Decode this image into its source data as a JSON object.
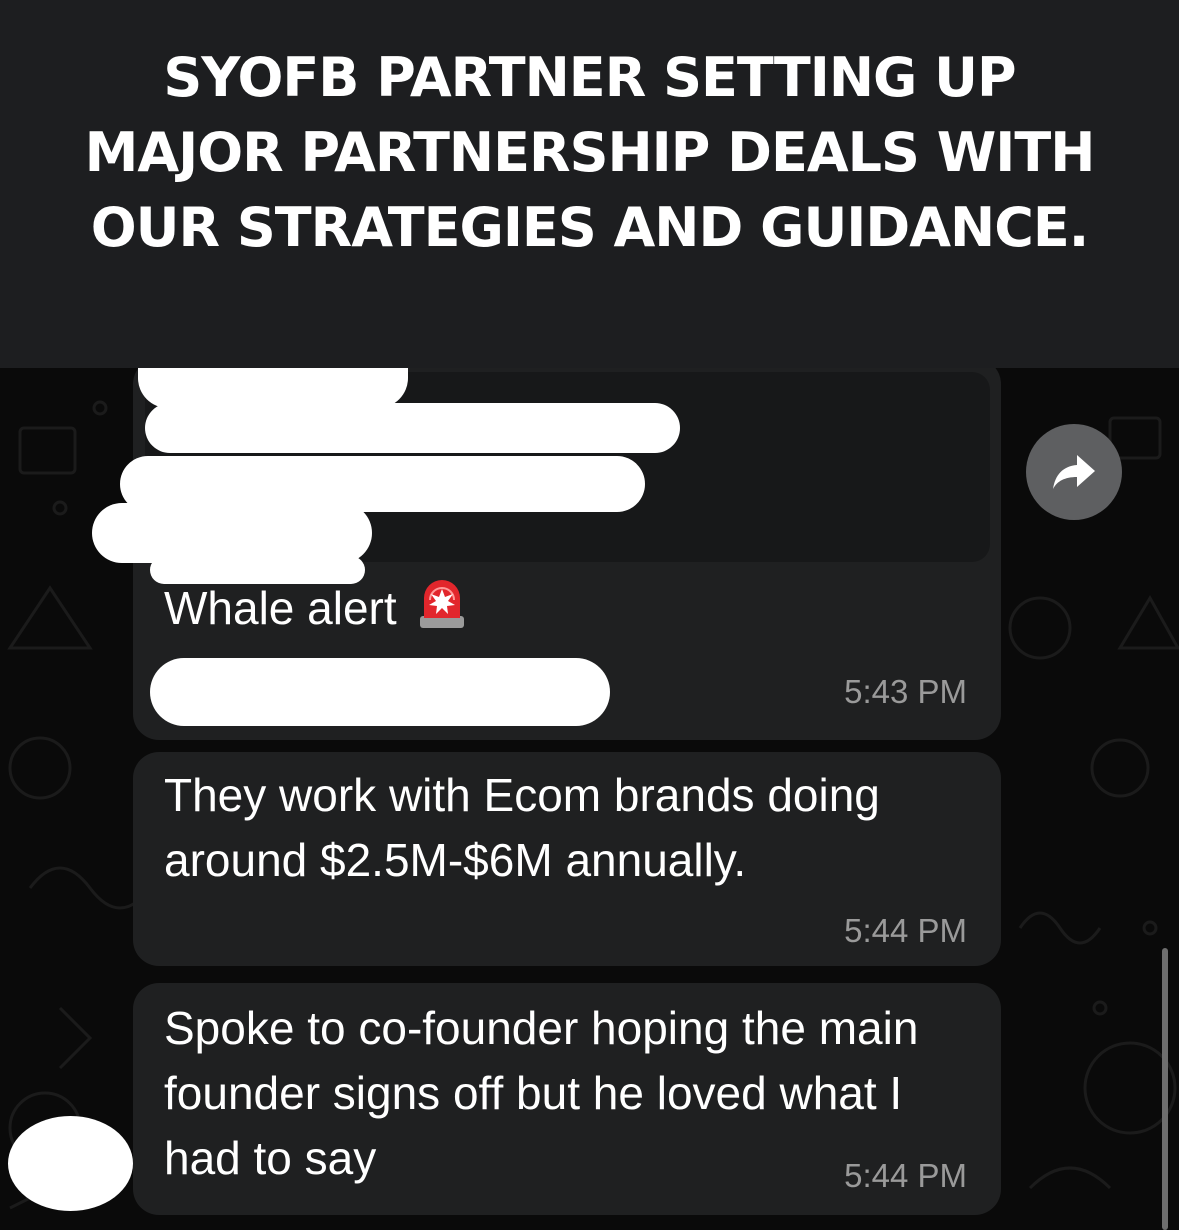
{
  "header": {
    "title": "SYOFB PARTNER SETTING UP MAJOR PARTNERSHIP DEALS WITH OUR STRATEGIES AND GUIDANCE."
  },
  "messages": [
    {
      "text": "Whale alert",
      "emoji": "rotating-light",
      "time": "5:43 PM"
    },
    {
      "text": "They work with Ecom brands doing around $2.5M-$6M annually.",
      "time": "5:44 PM"
    },
    {
      "text": "Spoke to co-founder hoping the main founder signs off but he loved what I had to say",
      "time": "5:44 PM"
    }
  ],
  "icons": {
    "forward": "forward-arrow-icon",
    "siren": "siren-emoji-icon"
  },
  "colors": {
    "header_bg": "#1d1e20",
    "chat_bg": "#0a0a0a",
    "bubble_bg": "#1f2021",
    "quote_bg": "#171819",
    "timestamp": "#9a9a9a",
    "forward_button": "#5e5f61"
  }
}
